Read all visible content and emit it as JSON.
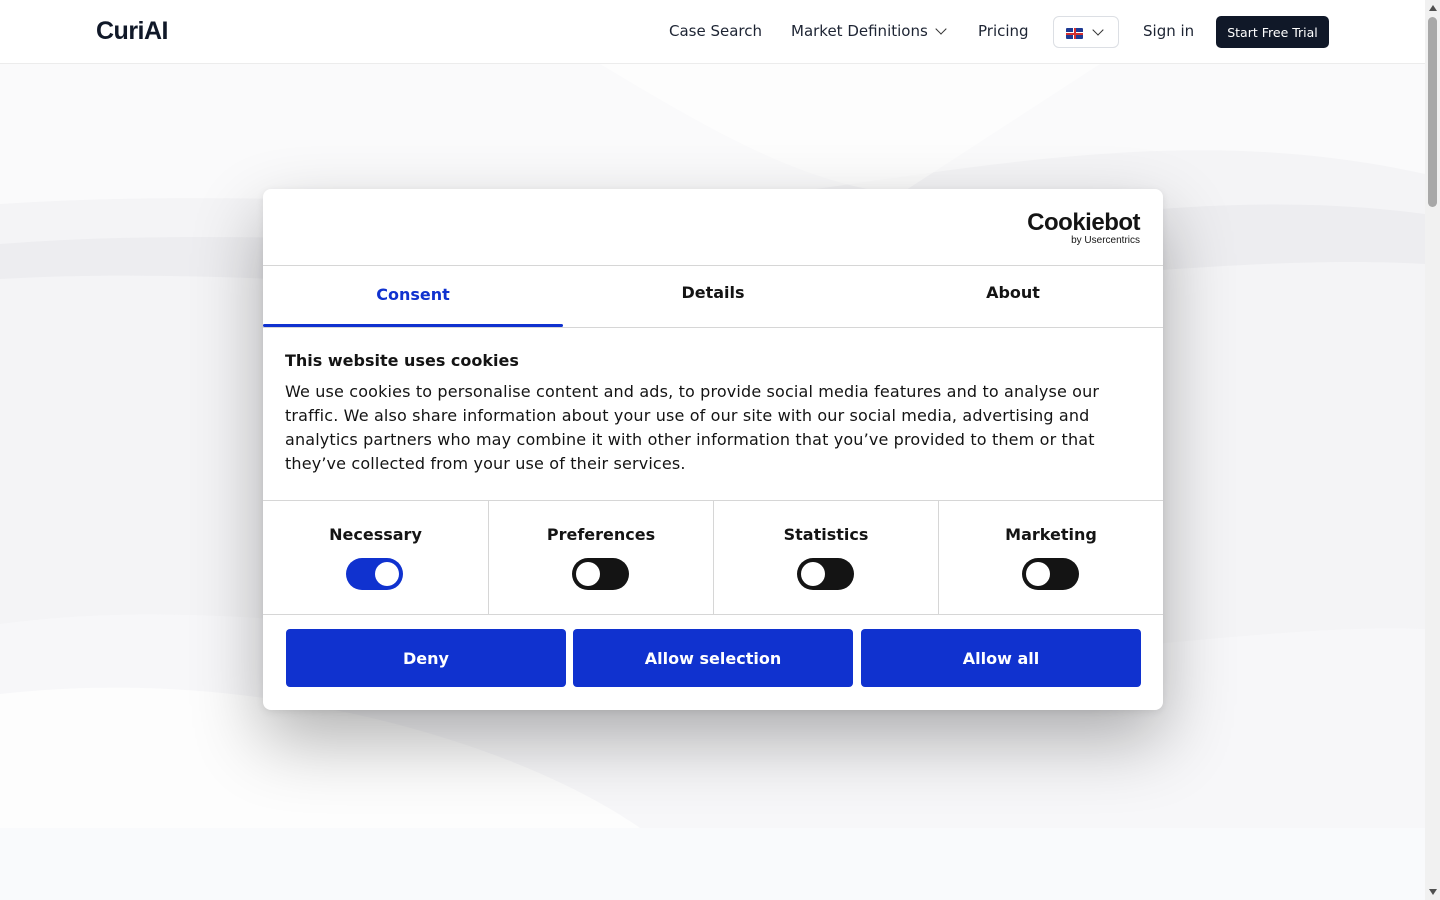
{
  "header": {
    "logo": "CuriAI",
    "nav": [
      "Case Search",
      "Market Definitions",
      "Pricing"
    ],
    "language_icon": "uk-flag-icon",
    "sign_in": "Sign in",
    "start_trial": "Start Free Trial"
  },
  "dialog": {
    "brand_name": "Cookiebot",
    "brand_sub": "by Usercentrics",
    "tabs": [
      {
        "label": "Consent",
        "active": true
      },
      {
        "label": "Details",
        "active": false
      },
      {
        "label": "About",
        "active": false
      }
    ],
    "title": "This website uses cookies",
    "body": "We use cookies to personalise content and ads, to provide social media features and to analyse our traffic. We also share information about your use of our site with our social media, advertising and analytics partners who may combine it with other information that you’ve provided to them or that they’ve collected from your use of their services.",
    "toggles": [
      {
        "label": "Necessary",
        "on": true
      },
      {
        "label": "Preferences",
        "on": false
      },
      {
        "label": "Statistics",
        "on": false
      },
      {
        "label": "Marketing",
        "on": false
      }
    ],
    "buttons": {
      "deny": "Deny",
      "allow_selection": "Allow selection",
      "allow_all": "Allow all"
    }
  },
  "colors": {
    "accent": "#1032cf",
    "dark": "#141414",
    "header_button": "#101828"
  }
}
